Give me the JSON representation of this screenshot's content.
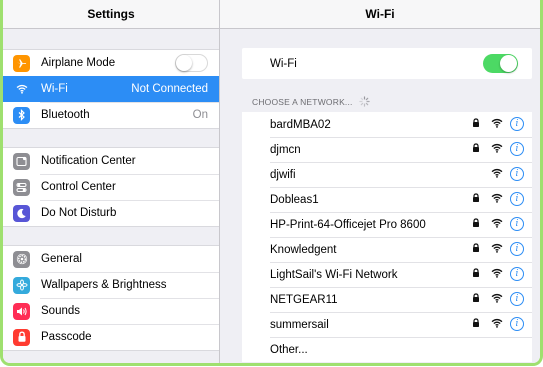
{
  "left": {
    "title": "Settings",
    "groups": [
      [
        {
          "label": "Airplane Mode",
          "icon": "airplane-icon",
          "color": "#ff9500",
          "control": "switch-off"
        },
        {
          "label": "Wi-Fi",
          "value": "Not Connected",
          "icon": "wifi-icon",
          "color": "#2c8df5",
          "selected": true
        },
        {
          "label": "Bluetooth",
          "value": "On",
          "icon": "bluetooth-icon",
          "color": "#2c8df5"
        }
      ],
      [
        {
          "label": "Notification Center",
          "icon": "notification-center-icon",
          "color": "#8e8e93"
        },
        {
          "label": "Control Center",
          "icon": "control-center-icon",
          "color": "#8e8e93"
        },
        {
          "label": "Do Not Disturb",
          "icon": "moon-icon",
          "color": "#5856d6"
        }
      ],
      [
        {
          "label": "General",
          "icon": "gear-icon",
          "color": "#8e8e93"
        },
        {
          "label": "Wallpapers & Brightness",
          "icon": "wallpaper-icon",
          "color": "#34aadc"
        },
        {
          "label": "Sounds",
          "icon": "speaker-icon",
          "color": "#ff2d55"
        },
        {
          "label": "Passcode",
          "icon": "lock-icon",
          "color": "#ff3b30"
        }
      ]
    ]
  },
  "right": {
    "title": "Wi-Fi",
    "wifi_label": "Wi-Fi",
    "wifi_on": true,
    "section_label": "CHOOSE A NETWORK...",
    "networks": [
      {
        "name": "bardMBA02",
        "secured": true
      },
      {
        "name": "djmcn",
        "secured": true
      },
      {
        "name": "djwifi",
        "secured": false
      },
      {
        "name": "Dobleas1",
        "secured": true
      },
      {
        "name": "HP-Print-64-Officejet Pro 8600",
        "secured": true
      },
      {
        "name": "Knowledgent",
        "secured": true
      },
      {
        "name": "LightSail's Wi-Fi Network",
        "secured": true
      },
      {
        "name": "NETGEAR11",
        "secured": true
      },
      {
        "name": "summersail",
        "secured": true
      },
      {
        "name": "Other...",
        "other": true
      }
    ]
  },
  "colors": {
    "accent": "#2c8df5",
    "toggle_on": "#4cd964",
    "frame": "#9fe06f"
  }
}
